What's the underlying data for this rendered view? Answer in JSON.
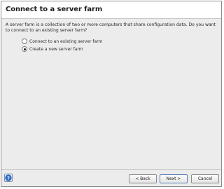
{
  "dialog": {
    "title": "Connect to a server farm",
    "description": "A server farm is a collection of two or more computers that share configuration data. Do you want to connect to an existing server farm?",
    "options": [
      {
        "label": "Connect to an existing server farm",
        "selected": false
      },
      {
        "label": "Create a new server farm",
        "selected": true
      }
    ]
  },
  "footer": {
    "back_label": "< Back",
    "next_label": "Next >",
    "cancel_label": "Cancel"
  },
  "icons": {
    "help": "help-icon"
  }
}
